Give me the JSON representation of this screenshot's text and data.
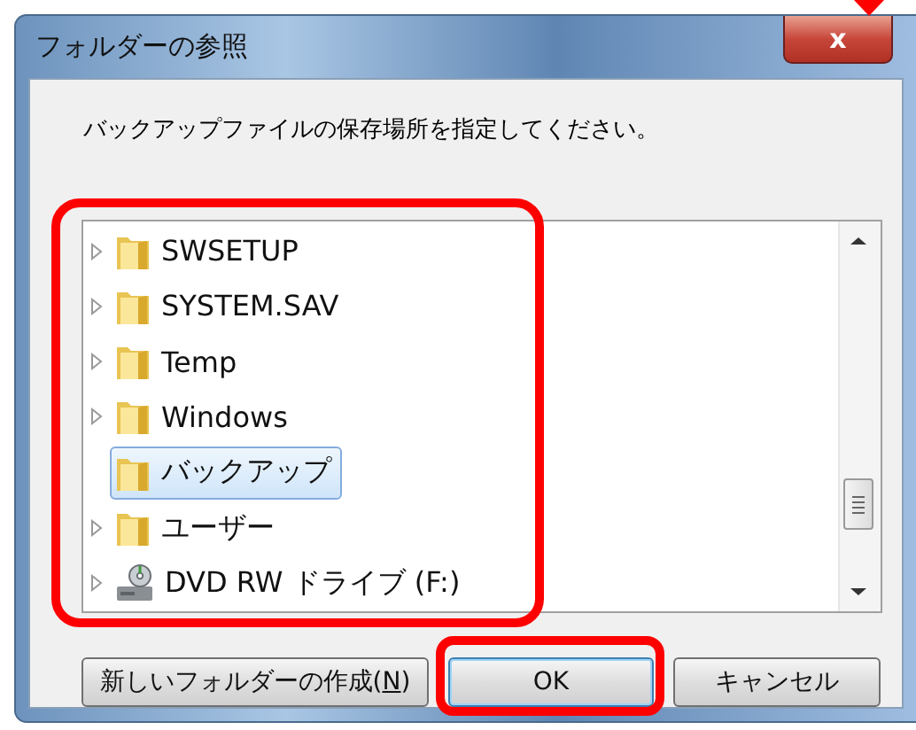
{
  "window": {
    "title": "フォルダーの参照",
    "close": "x"
  },
  "instruction": "バックアップファイルの保存場所を指定してください。",
  "tree": [
    {
      "children": [
        {
          "label": "SWSETUP",
          "kind": "folder",
          "has_children": true,
          "selected": false
        },
        {
          "label": "SYSTEM.SAV",
          "kind": "folder",
          "has_children": true,
          "selected": false
        },
        {
          "label": "Temp",
          "kind": "folder",
          "has_children": true,
          "selected": false
        },
        {
          "label": "Windows",
          "kind": "folder",
          "has_children": true,
          "selected": false
        },
        {
          "label": "バックアップ",
          "kind": "folder",
          "has_children": false,
          "selected": true
        },
        {
          "label": "ユーザー",
          "kind": "folder",
          "has_children": true,
          "selected": false
        }
      ]
    },
    {
      "label": "DVD RW ドライブ (F:)",
      "kind": "drive",
      "has_children": true,
      "selected": false
    }
  ],
  "buttons": [
    {
      "label": "新しいフォルダーの作成(**N**)",
      "default": false
    },
    {
      "label": "OK",
      "default": true
    },
    {
      "label": "キャンセル",
      "default": false
    }
  ],
  "highlights": {
    "tree": true,
    "ok_button": true,
    "arrow": true
  }
}
